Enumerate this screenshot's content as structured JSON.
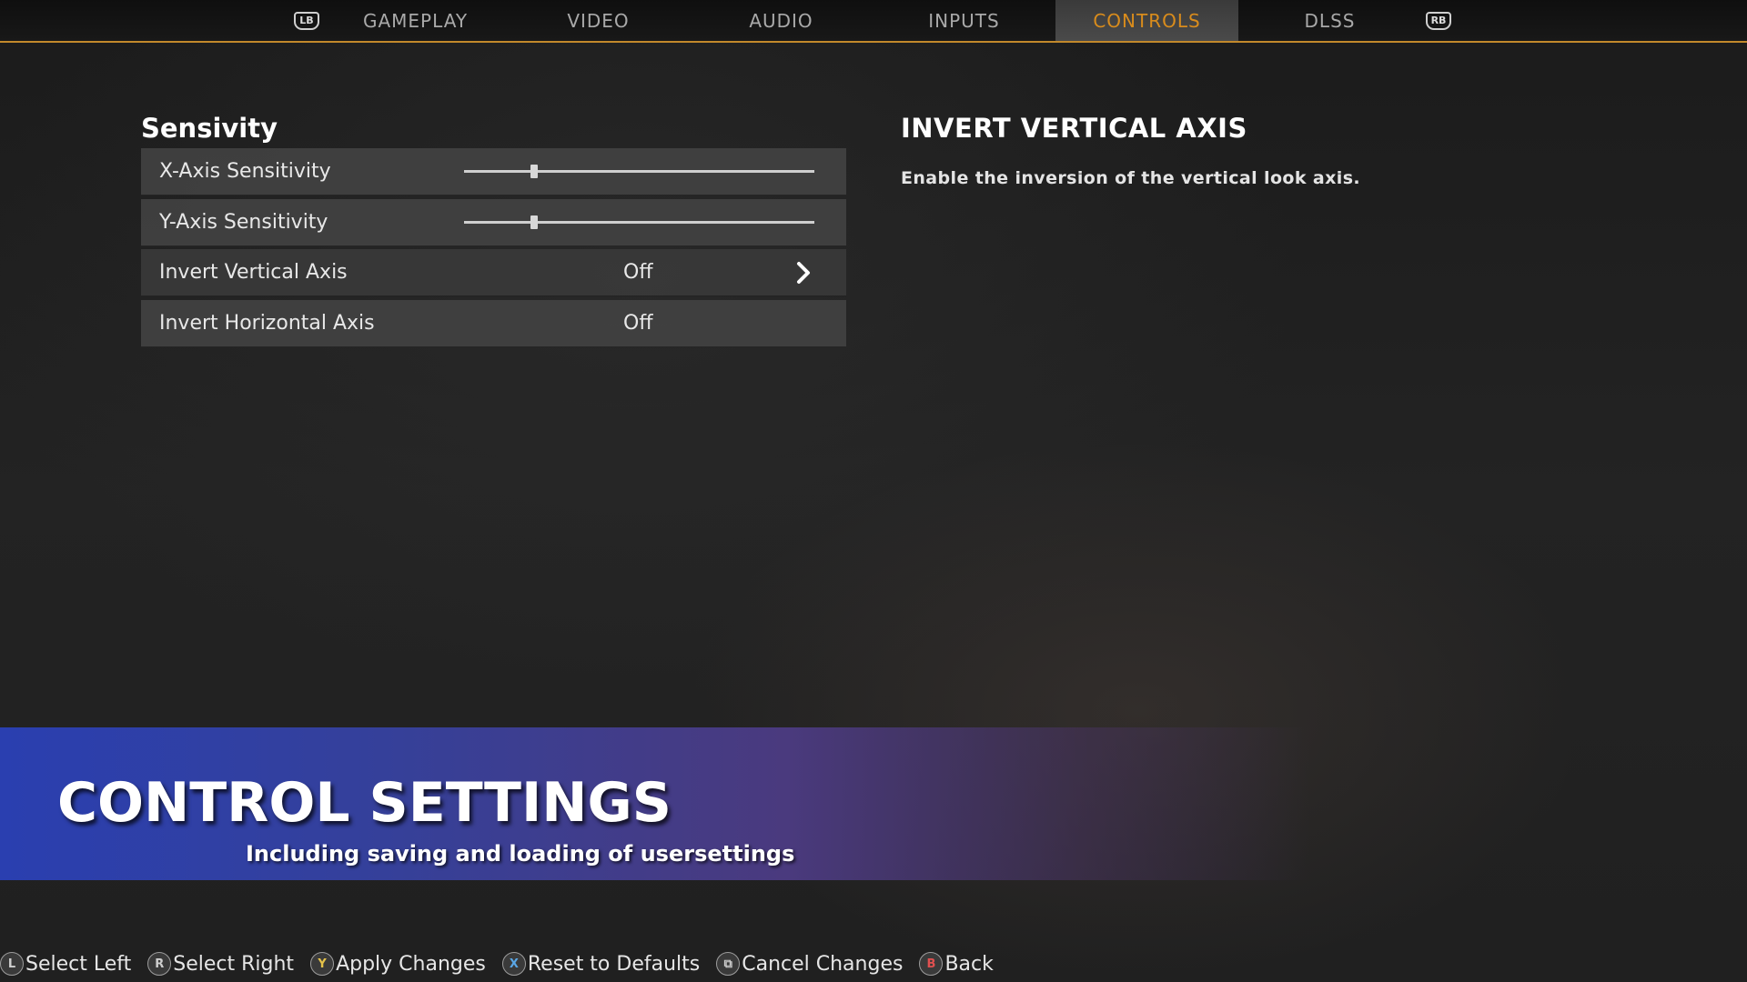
{
  "tabs": {
    "left_bumper": "LB",
    "right_bumper": "RB",
    "items": [
      {
        "label": "GAMEPLAY"
      },
      {
        "label": "VIDEO"
      },
      {
        "label": "AUDIO"
      },
      {
        "label": "INPUTS"
      },
      {
        "label": "CONTROLS"
      },
      {
        "label": "DLSS"
      }
    ],
    "active": "CONTROLS",
    "accent_color": "#d98c1c"
  },
  "settings": {
    "section_title": "Sensivity",
    "rows": [
      {
        "label": "X-Axis Sensitivity",
        "type": "slider",
        "level": 0.2
      },
      {
        "label": "Y-Axis Sensitivity",
        "type": "slider",
        "level": 0.2
      },
      {
        "label": "Invert Vertical Axis",
        "type": "toggle",
        "value": "Off",
        "selected": true
      },
      {
        "label": "Invert Horizontal Axis",
        "type": "toggle",
        "value": "Off"
      }
    ]
  },
  "description": {
    "title": "INVERT VERTICAL AXIS",
    "text": "Enable the inversion of the vertical look axis."
  },
  "banner": {
    "title": "CONTROL SETTINGS",
    "subtitle": "Including saving and loading of usersettings"
  },
  "hints": [
    {
      "glyph": "L",
      "label": "Select Left",
      "icon": "left-stick-icon",
      "color": "#cfcfcf"
    },
    {
      "glyph": "R",
      "label": "Select Right",
      "icon": "right-stick-icon",
      "color": "#cfcfcf"
    },
    {
      "glyph": "Y",
      "label": "Apply Changes",
      "icon": "y-button-icon",
      "color": "#e6c34a"
    },
    {
      "glyph": "X",
      "label": "Reset to Defaults",
      "icon": "x-button-icon",
      "color": "#5aa7e6"
    },
    {
      "glyph": "⧉",
      "label": "Cancel Changes",
      "icon": "view-button-icon",
      "color": "#cfcfcf"
    },
    {
      "glyph": "B",
      "label": "Back",
      "icon": "b-button-icon",
      "color": "#e05050"
    }
  ]
}
